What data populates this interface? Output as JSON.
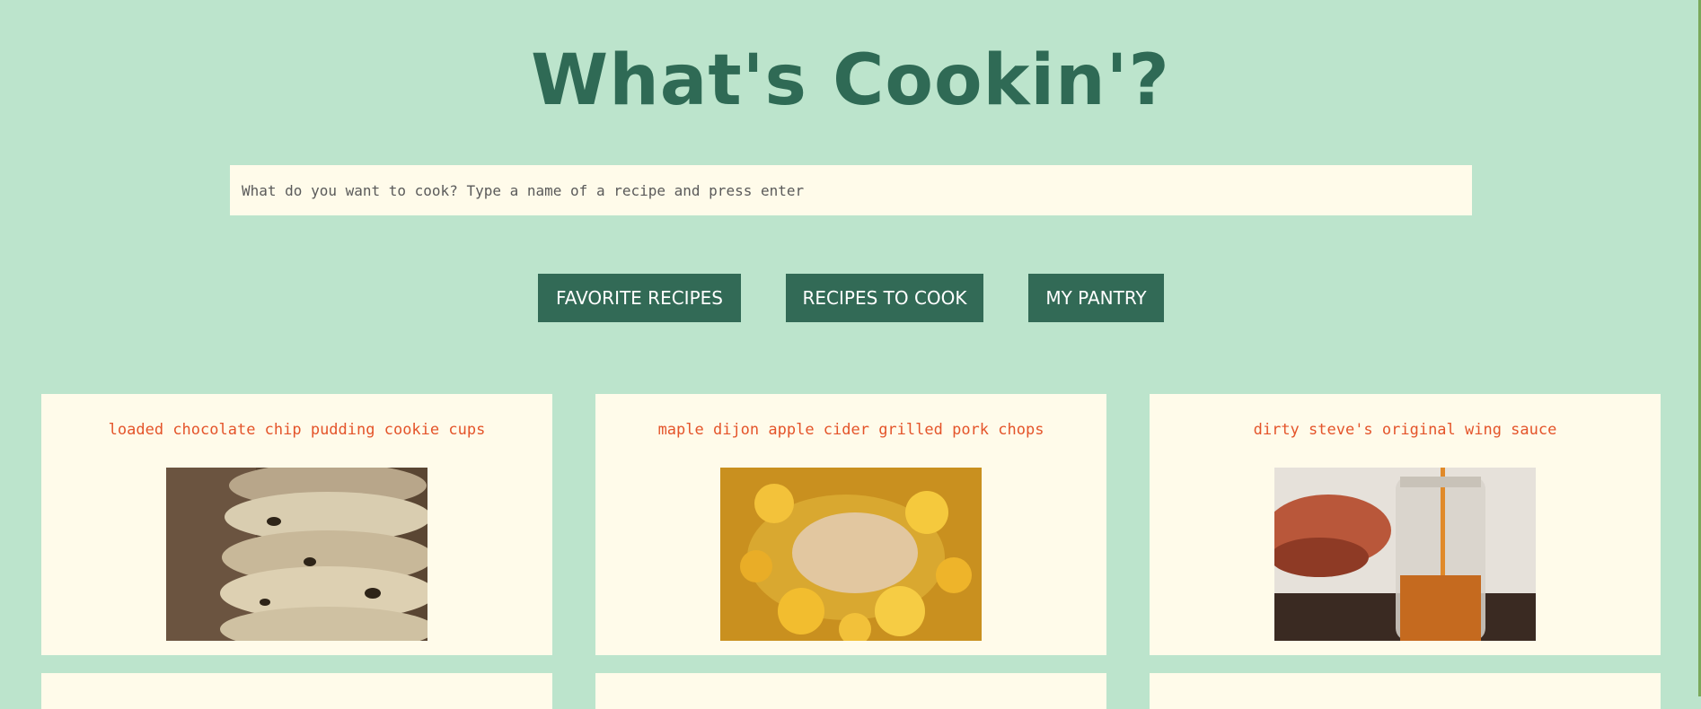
{
  "header": {
    "title": "What's Cookin'?"
  },
  "search": {
    "placeholder": "What do you want to cook? Type a name of a recipe and press enter"
  },
  "nav": {
    "favorites": "FAVORITE RECIPES",
    "to_cook": "RECIPES TO COOK",
    "pantry": "MY PANTRY"
  },
  "recipes": [
    {
      "name": "loaded chocolate chip pudding cookie cups"
    },
    {
      "name": "maple dijon apple cider grilled pork chops"
    },
    {
      "name": "dirty steve's original wing sauce"
    }
  ],
  "colors": {
    "background": "#bce4cc",
    "title": "#2f6a55",
    "button": "#326a56",
    "card": "#fffbea",
    "recipe_name": "#e4542a"
  }
}
